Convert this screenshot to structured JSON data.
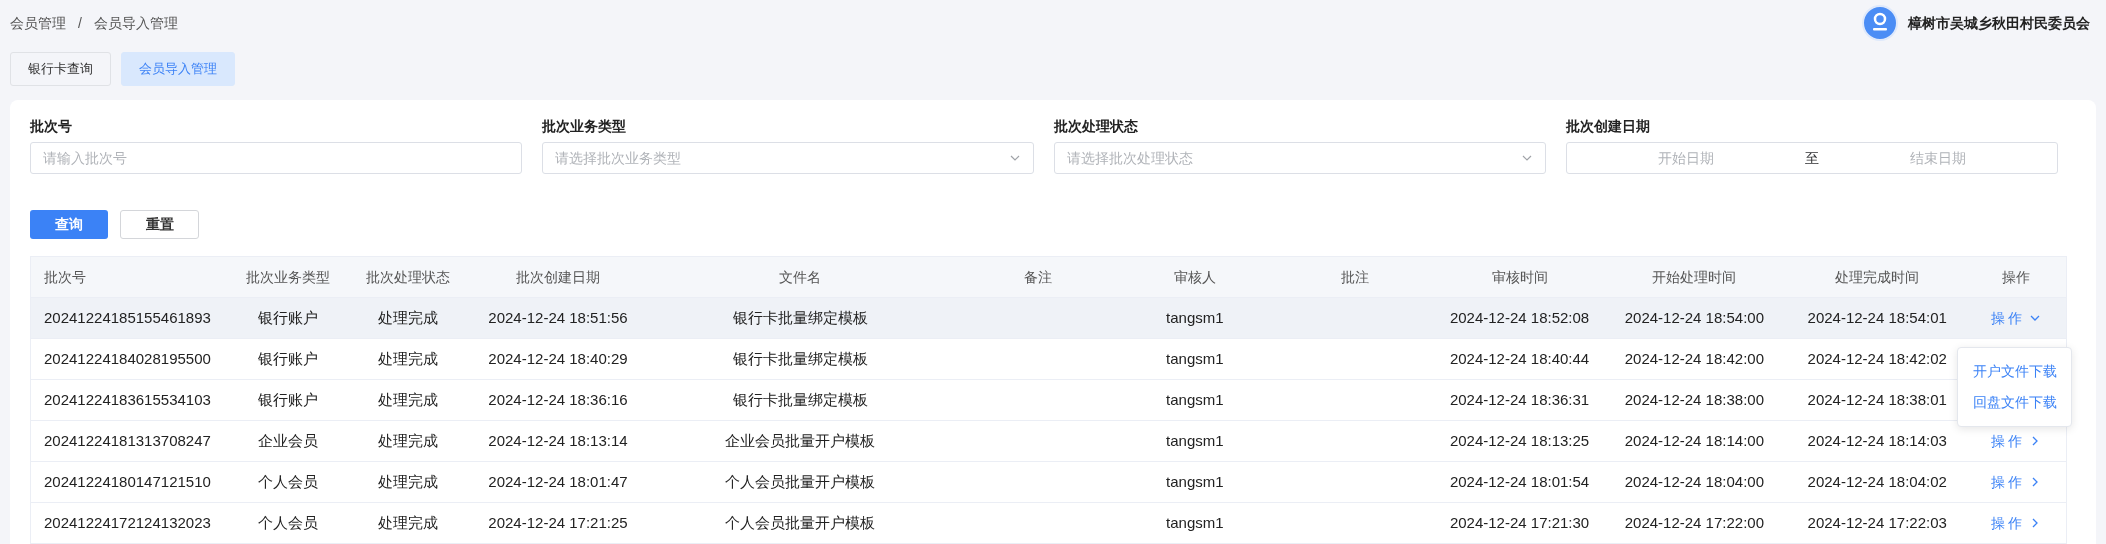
{
  "breadcrumb": [
    "会员管理",
    "/",
    "会员导入管理"
  ],
  "user": {
    "name": "樟树市吴城乡秋田村民委员会"
  },
  "tabs": [
    {
      "label": "银行卡查询",
      "selected": false
    },
    {
      "label": "会员导入管理",
      "selected": true
    }
  ],
  "filters": [
    {
      "kind": "text",
      "label": "批次号",
      "placeholder": "请输入批次号"
    },
    {
      "kind": "select",
      "label": "批次业务类型",
      "placeholder": "请选择批次业务类型"
    },
    {
      "kind": "select",
      "label": "批次处理状态",
      "placeholder": "请选择批次处理状态"
    },
    {
      "kind": "daterange",
      "label": "批次创建日期",
      "start_placeholder": "开始日期",
      "separator": "至",
      "end_placeholder": "结束日期"
    }
  ],
  "buttons": [
    {
      "kind": "primary",
      "label": "查询"
    },
    {
      "kind": "default",
      "label": "重置"
    }
  ],
  "table": {
    "columns": [
      "批次号",
      "批次业务类型",
      "批次处理状态",
      "批次创建日期",
      "文件名",
      "备注",
      "审核人",
      "批注",
      "审核时间",
      "开始处理时间",
      "处理完成时间",
      "操作"
    ],
    "rows": [
      {
        "highlighted": true,
        "cells": [
          "20241224185155461893",
          "银行账户",
          "处理完成",
          "2024-12-24 18:51:56",
          "银行卡批量绑定模板",
          "",
          "tangsm1",
          "",
          "2024-12-24 18:52:08",
          "2024-12-24 18:54:00",
          "2024-12-24 18:54:01"
        ],
        "action": {
          "label": "操 作",
          "expanded": true,
          "menu": [
            "开户文件下载",
            "回盘文件下载"
          ]
        }
      },
      {
        "highlighted": false,
        "cells": [
          "20241224184028195500",
          "银行账户",
          "处理完成",
          "2024-12-24 18:40:29",
          "银行卡批量绑定模板",
          "",
          "tangsm1",
          "",
          "2024-12-24 18:40:44",
          "2024-12-24 18:42:00",
          "2024-12-24 18:42:02"
        ]
      },
      {
        "highlighted": false,
        "cells": [
          "20241224183615534103",
          "银行账户",
          "处理完成",
          "2024-12-24 18:36:16",
          "银行卡批量绑定模板",
          "",
          "tangsm1",
          "",
          "2024-12-24 18:36:31",
          "2024-12-24 18:38:00",
          "2024-12-24 18:38:01"
        ]
      },
      {
        "highlighted": false,
        "cells": [
          "20241224181313708247",
          "企业会员",
          "处理完成",
          "2024-12-24 18:13:14",
          "企业会员批量开户模板",
          "",
          "tangsm1",
          "",
          "2024-12-24 18:13:25",
          "2024-12-24 18:14:00",
          "2024-12-24 18:14:03"
        ],
        "action": {
          "label": "操 作",
          "expanded": false
        }
      },
      {
        "highlighted": false,
        "cells": [
          "20241224180147121510",
          "个人会员",
          "处理完成",
          "2024-12-24 18:01:47",
          "个人会员批量开户模板",
          "",
          "tangsm1",
          "",
          "2024-12-24 18:01:54",
          "2024-12-24 18:04:00",
          "2024-12-24 18:04:02"
        ],
        "action": {
          "label": "操 作",
          "expanded": false
        }
      },
      {
        "highlighted": false,
        "cells": [
          "20241224172124132023",
          "个人会员",
          "处理完成",
          "2024-12-24 17:21:25",
          "个人会员批量开户模板",
          "",
          "tangsm1",
          "",
          "2024-12-24 17:21:30",
          "2024-12-24 17:22:00",
          "2024-12-24 17:22:03"
        ],
        "action": {
          "label": "操 作",
          "expanded": false
        }
      }
    ]
  }
}
